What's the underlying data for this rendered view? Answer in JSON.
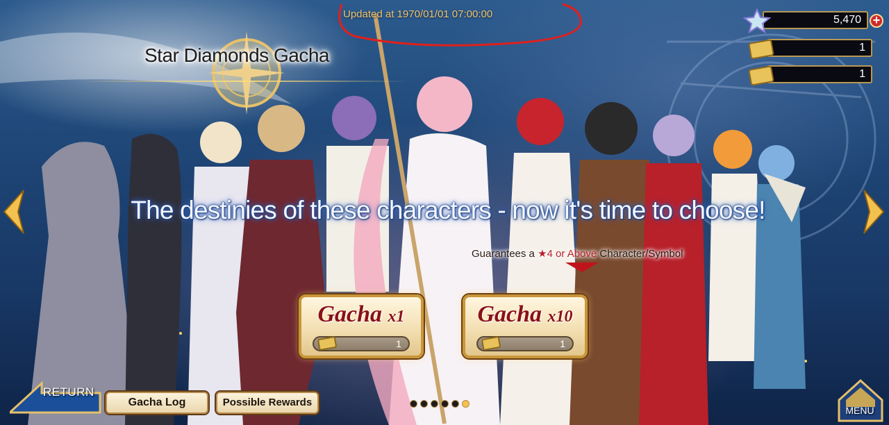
{
  "title": "Star Diamonds Gacha",
  "updated_text": "Updated at 1970/01/01 07:00:00",
  "tagline": "The destinies of these characters - now it's time to choose!",
  "guarantee": {
    "prefix": "Guarantees a ",
    "highlight": "★4 or Above",
    "suffix": " Character/Symbol"
  },
  "currencies": [
    {
      "icon": "star-diamond-icon",
      "value": "5,470"
    },
    {
      "icon": "ticket-icon",
      "value": "1"
    },
    {
      "icon": "ticket-icon",
      "value": "1"
    }
  ],
  "gacha_buttons": [
    {
      "label": "Gacha",
      "multiplier": "x1",
      "cost": "1",
      "cost_icon": "ticket-icon"
    },
    {
      "label": "Gacha",
      "multiplier": "x10",
      "cost": "1",
      "cost_icon": "ticket-icon"
    }
  ],
  "bottom": {
    "return_label": "RETURN",
    "gacha_log": "Gacha Log",
    "possible_rewards": "Possible Rewards",
    "menu_label": "MENU"
  },
  "pagination": {
    "total": 6,
    "active": 6
  },
  "colors": {
    "gold": "#f2c56b",
    "gacha_text": "#8a1016",
    "guarantee_highlight": "#b8202a",
    "plus_red": "#d02a2a",
    "annotation_red": "#e0201c"
  }
}
